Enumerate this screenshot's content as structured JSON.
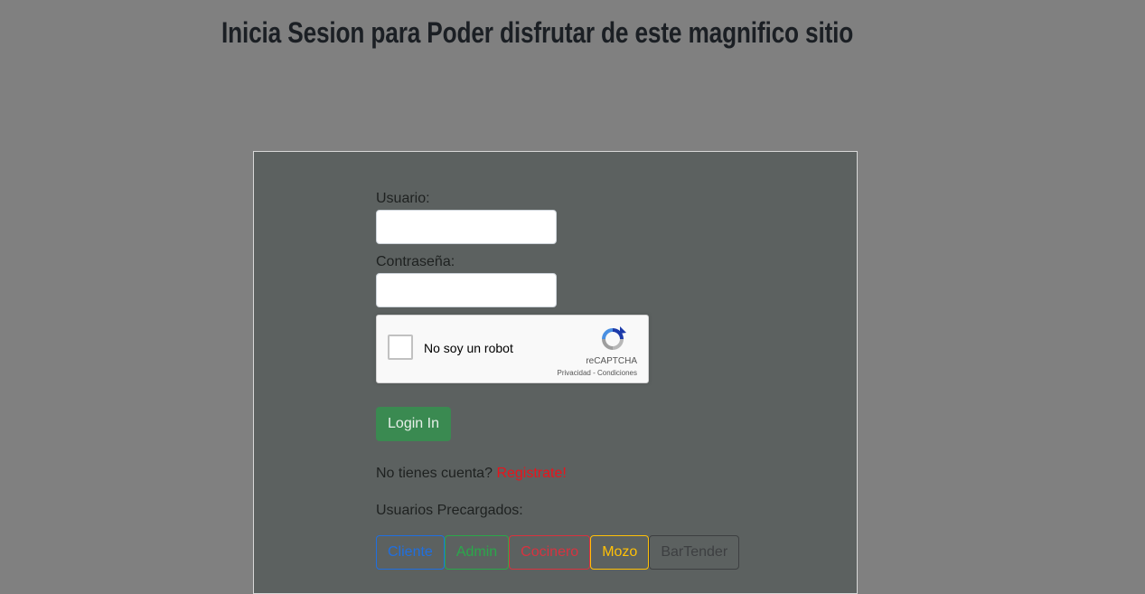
{
  "header": {
    "title": "Inicia Sesion para Poder disfrutar de este magnifico sitio"
  },
  "login_form": {
    "username_label": "Usuario:",
    "username_value": "",
    "password_label": "Contraseña:",
    "password_value": "",
    "recaptcha": {
      "label": "No soy un robot",
      "brand": "reCAPTCHA",
      "privacy_link": "Privacidad",
      "separator": " - ",
      "terms_link": "Condiciones",
      "icon": "recaptcha-logo-icon"
    },
    "login_button": "Login In",
    "signup_prompt": "No tienes cuenta?",
    "signup_link": "Registrate!"
  },
  "preloaded_users": {
    "label": "Usuarios Precargados:",
    "buttons": [
      {
        "label": "Cliente",
        "color": "#1f6fe0"
      },
      {
        "label": "Admin",
        "color": "#2aa84a"
      },
      {
        "label": "Cocinero",
        "color": "#d9323f"
      },
      {
        "label": "Mozo",
        "color": "#ffc107"
      },
      {
        "label": "BarTender",
        "color": "#3d3f41"
      }
    ]
  },
  "colors": {
    "page_background": "#808080",
    "panel_background": "#5c6160",
    "login_button": "#3a8a51",
    "signup_link": "#e8141c"
  }
}
